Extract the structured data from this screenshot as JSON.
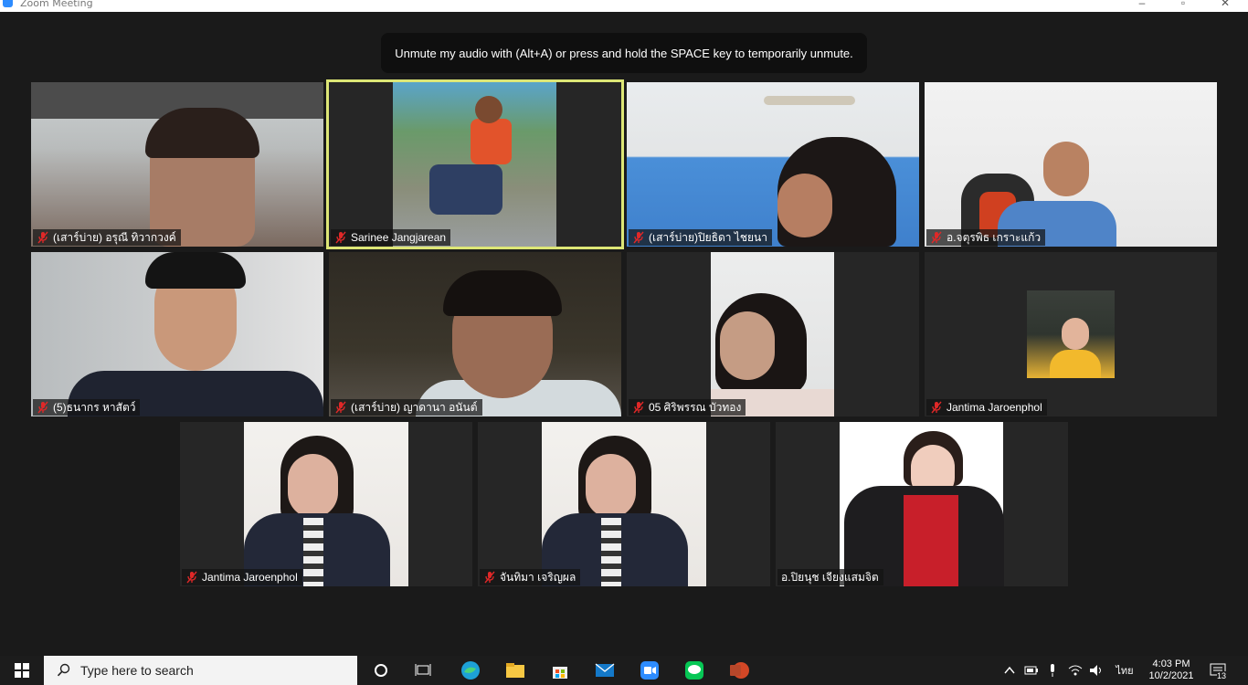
{
  "window": {
    "title": "Zoom Meeting"
  },
  "toast": {
    "text": "Unmute my audio with (Alt+A) or press and hold the SPACE key to temporarily unmute."
  },
  "participants": [
    {
      "name": "(เสาร์บ่าย) อรุณี ทิวากวงค์",
      "muted": true
    },
    {
      "name": "Sarinee Jangjarean",
      "muted": true,
      "active": true
    },
    {
      "name": "(เสาร์บ่าย)ปิยธิดา ไชยนา",
      "muted": true
    },
    {
      "name": "อ.จตุรพิธ เกราะแก้ว",
      "muted": true
    },
    {
      "name": "(5)ธนากร หาสัตว์",
      "muted": true
    },
    {
      "name": "(เสาร์บ่าย) ญาดานา อนันต์",
      "muted": true
    },
    {
      "name": "05 ศิริพรรณ บัวทอง",
      "muted": true
    },
    {
      "name": "Jantima Jaroenphol",
      "muted": true
    },
    {
      "name": "Jantima Jaroenphol",
      "muted": true
    },
    {
      "name": "จันทิมา เจริญผล",
      "muted": true
    },
    {
      "name": "อ.ปิยนุช เจียงแสมจิต",
      "muted": false
    }
  ],
  "taskbar": {
    "search_placeholder": "Type here to search",
    "time": "4:03 PM",
    "date": "10/2/2021",
    "language": "ไทย",
    "notifications_count": "13"
  },
  "colors": {
    "active_border": "#dde676",
    "mute_red": "#e02828",
    "zoom_blue": "#2d8cff"
  }
}
